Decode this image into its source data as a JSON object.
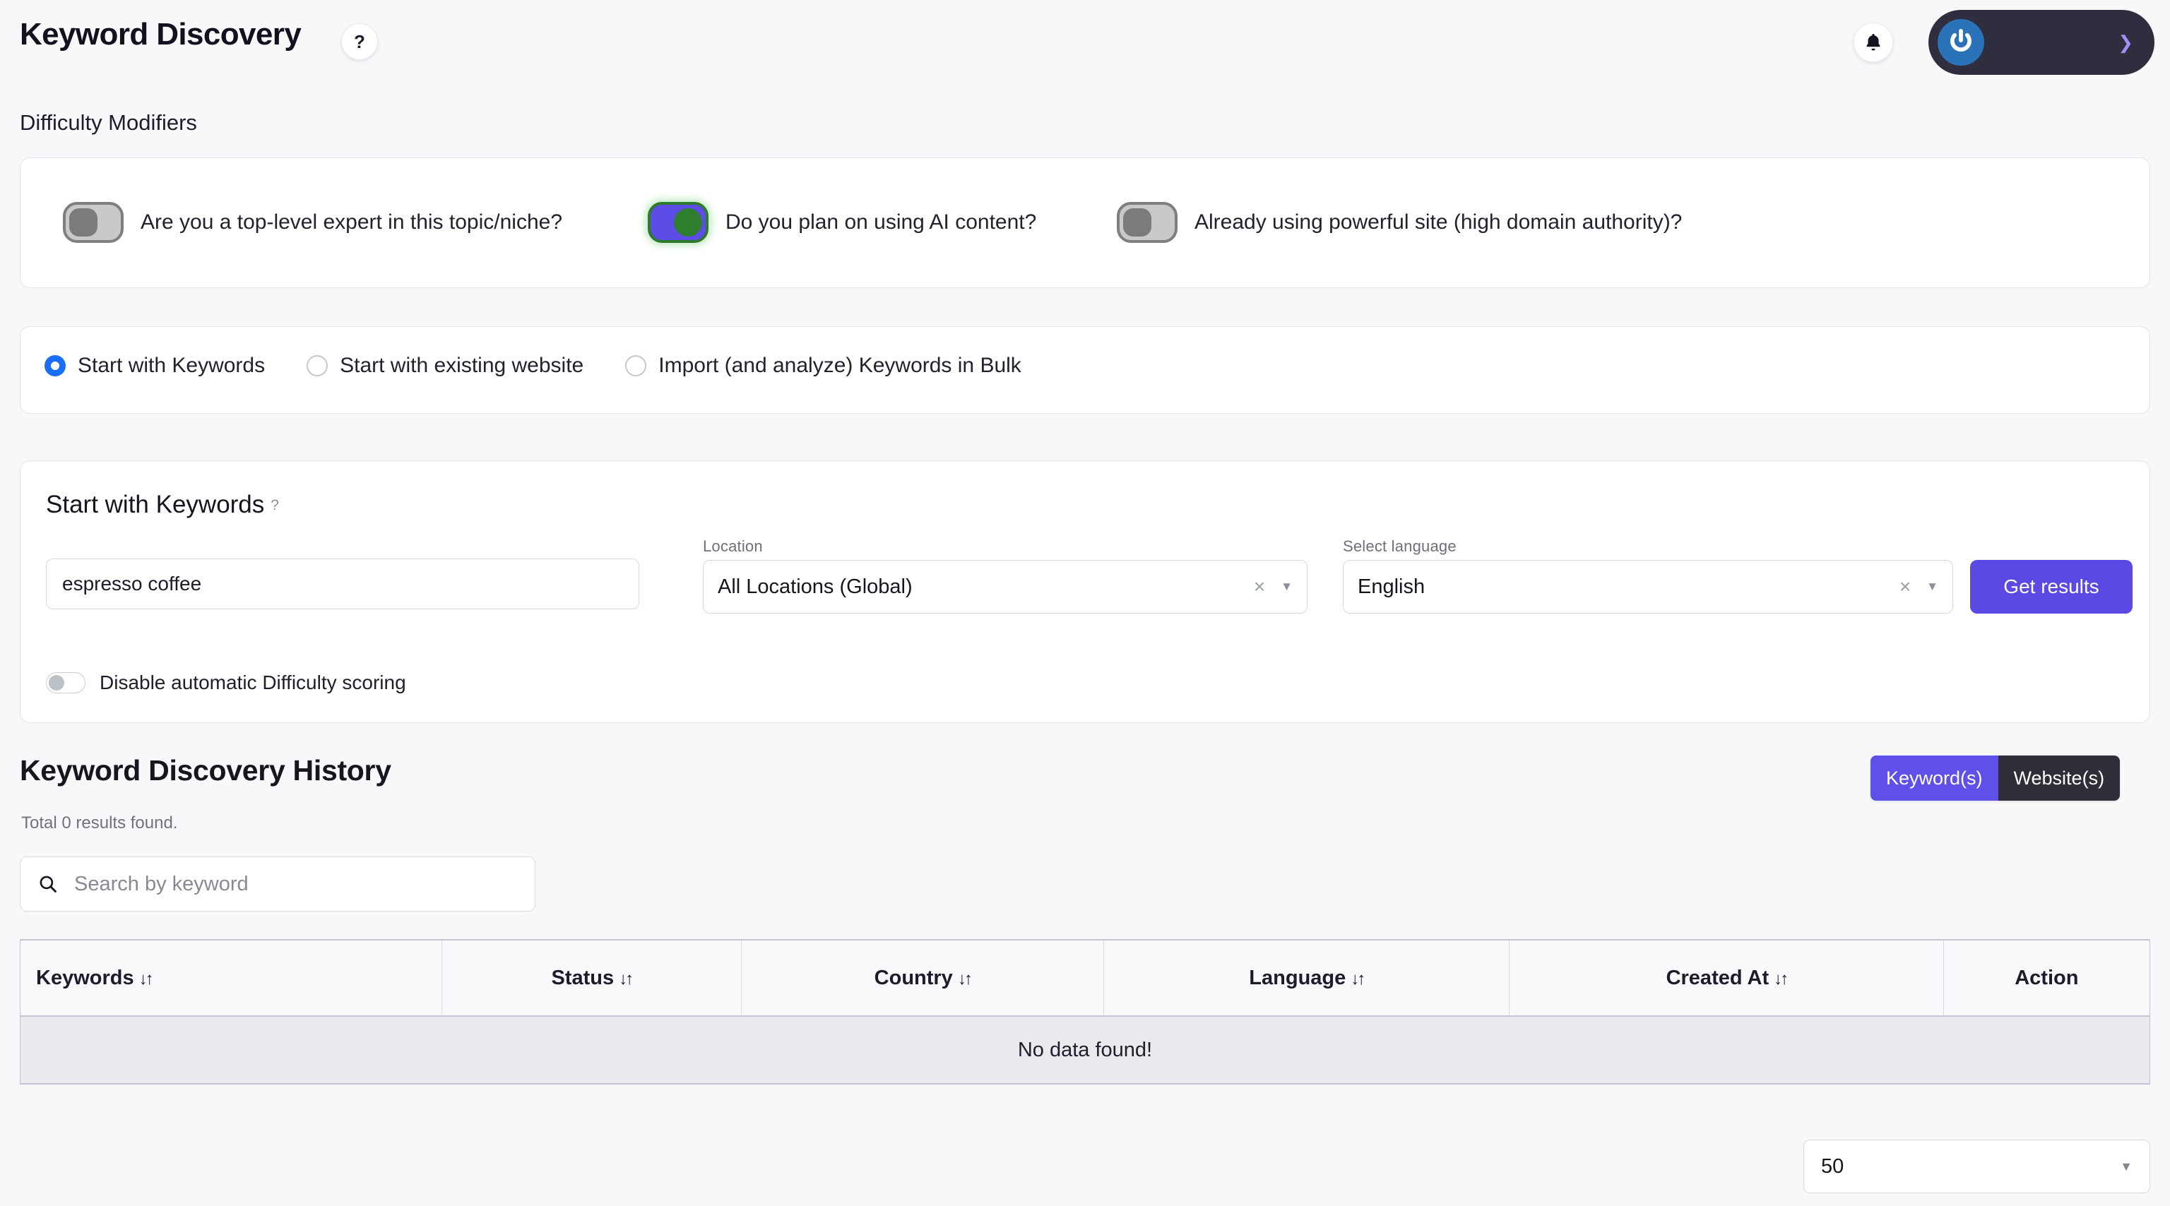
{
  "header": {
    "title": "Keyword Discovery",
    "help_label": "?",
    "bell_icon": "bell-icon",
    "account_logo_icon": "power-logo-icon",
    "account_chevron": "chevron-down-icon"
  },
  "difficulty": {
    "section_label": "Difficulty Modifiers",
    "toggles": [
      {
        "label": "Are you a top-level expert in this topic/niche?",
        "state": "off"
      },
      {
        "label": "Do you plan on using AI content?",
        "state": "on"
      },
      {
        "label": "Already using powerful site (high domain authority)?",
        "state": "off"
      }
    ]
  },
  "mode": {
    "options": [
      {
        "label": "Start with Keywords",
        "selected": true
      },
      {
        "label": "Start with existing website",
        "selected": false
      },
      {
        "label": "Import (and analyze) Keywords in Bulk",
        "selected": false
      }
    ]
  },
  "keywords_panel": {
    "title": "Start with Keywords",
    "title_help": "?",
    "keyword_value": "espresso coffee",
    "keyword_placeholder": "",
    "location_label": "Location",
    "location_value": "All Locations (Global)",
    "language_label": "Select language",
    "language_value": "English",
    "clear_icon": "×",
    "caret_icon": "▼",
    "get_results_label": "Get results",
    "disable_scoring_label": "Disable automatic Difficulty scoring",
    "disable_scoring_state": "off"
  },
  "history": {
    "title": "Keyword Discovery History",
    "total_text": "Total 0 results found.",
    "segmented": [
      {
        "label": "Keyword(s)",
        "active": true
      },
      {
        "label": "Website(s)",
        "active": false
      }
    ],
    "search_placeholder": "Search by keyword",
    "search_icon": "search-icon",
    "columns": [
      {
        "label": "Keywords",
        "sortable": true
      },
      {
        "label": "Status",
        "sortable": true
      },
      {
        "label": "Country",
        "sortable": true
      },
      {
        "label": "Language",
        "sortable": true
      },
      {
        "label": "Created At",
        "sortable": true
      },
      {
        "label": "Action",
        "sortable": false
      }
    ],
    "sort_icon": "↓↑",
    "empty_text": "No data found!",
    "page_size_value": "50",
    "page_size_caret": "▼"
  },
  "colors": {
    "accent_purple": "#5a4ae3",
    "accent_blue": "#1a6ef5",
    "dark": "#2e2e38",
    "toggle_on_green": "#2f7d2f",
    "table_border": "#c7c3d6"
  }
}
